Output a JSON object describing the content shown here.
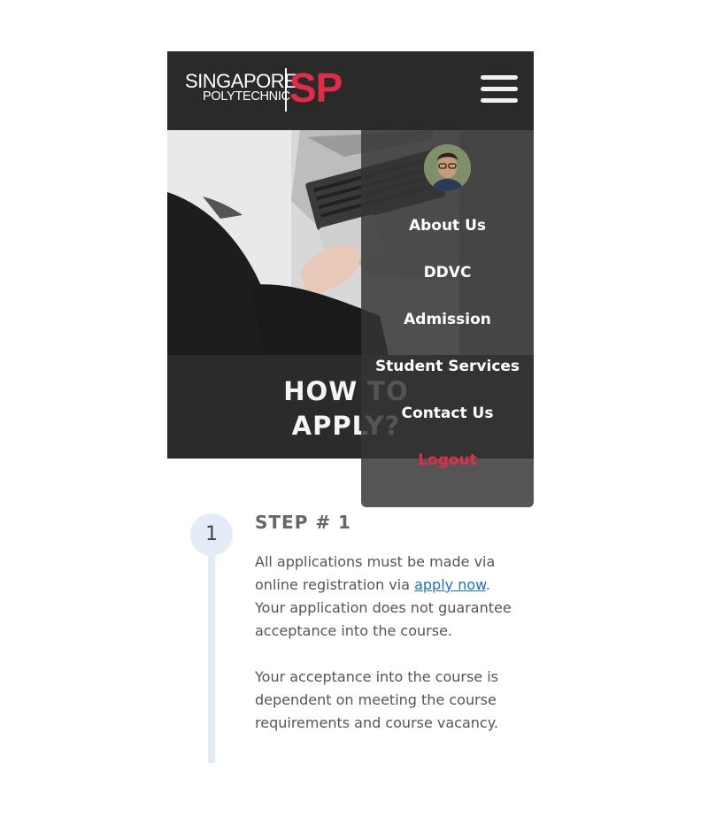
{
  "header": {
    "logo": {
      "line1": "SINGAPORE",
      "line2": "POLYTECHNIC",
      "mark": "SP",
      "brand_color": "#e32b47"
    },
    "menu_icon": "hamburger-icon"
  },
  "hero": {
    "title_line1": "HOW TO",
    "title_line2": "APPLY?"
  },
  "menu": {
    "avatar_icon": "user-avatar",
    "items": [
      {
        "label": "About Us"
      },
      {
        "label": "DDVC"
      },
      {
        "label": "Admission"
      },
      {
        "label": "Student Services"
      },
      {
        "label": "Contact Us"
      }
    ],
    "logout": "Logout",
    "logout_color": "#e32b47"
  },
  "step": {
    "number": "1",
    "title": "STEP # 1",
    "para1_before": "All applications must be made via online registration via ",
    "para1_link": "apply now",
    "para1_after": ". Your application does not guarantee acceptance into the course.",
    "para2": "Your acceptance into the course is dependent on meeting the course requirements and course vacancy."
  }
}
